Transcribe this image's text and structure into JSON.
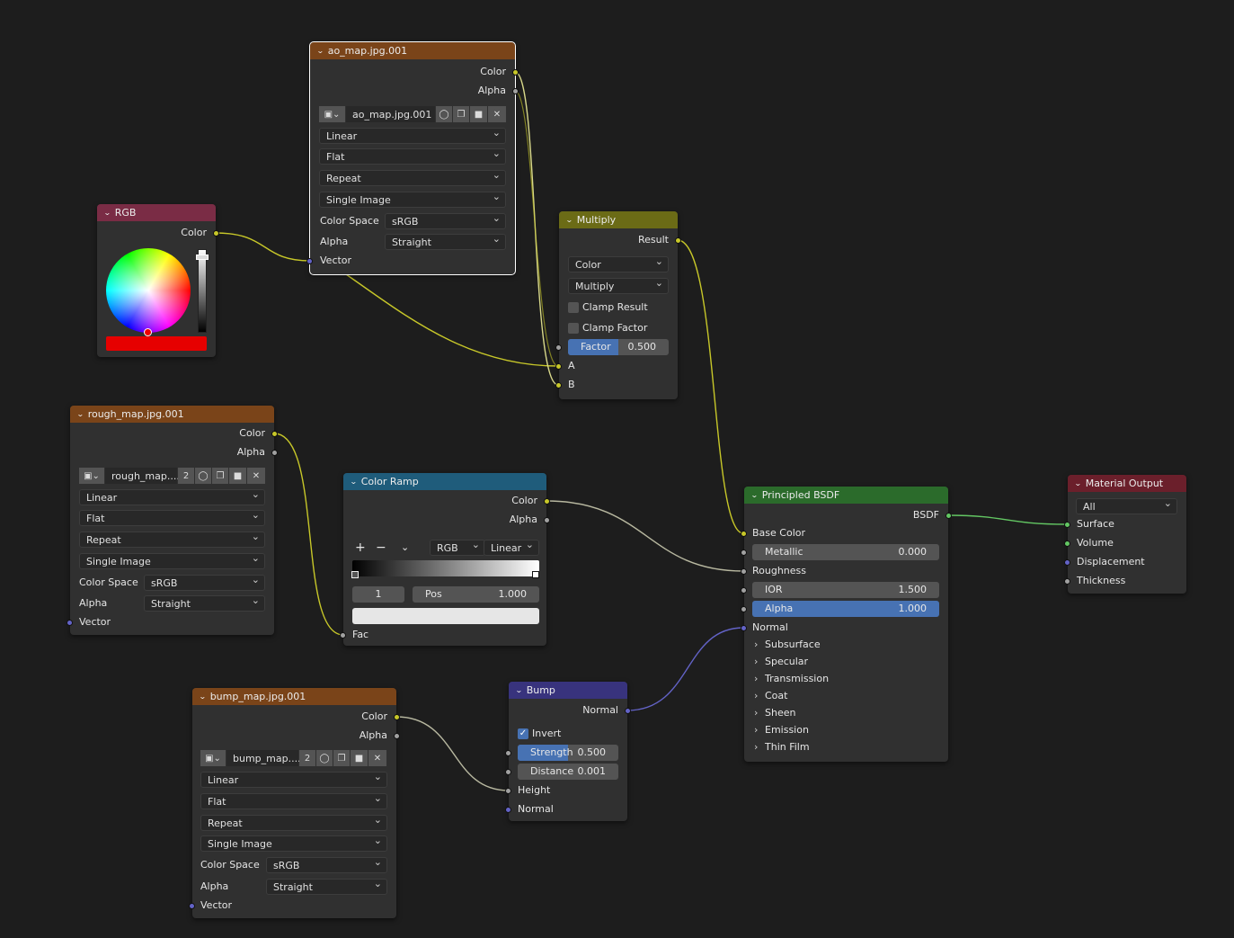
{
  "colors": {
    "canvas": "#1d1d1d",
    "header_texture": "#7a4419",
    "header_color": "#7a2c45",
    "header_converter": "#6b6b16",
    "header_ramp": "#1f5c7b",
    "header_vector": "#38337d",
    "header_shader": "#2b6b2b",
    "header_output": "#6b1f2b",
    "socket_color": "#c7c729",
    "socket_float": "#a1a1a1",
    "socket_vector": "#6363c7",
    "socket_shader": "#63c763",
    "accent": "#4772b3"
  },
  "ao_node": {
    "title": "ao_map.jpg.001",
    "out_color": "Color",
    "out_alpha": "Alpha",
    "image_name": "ao_map.jpg.001",
    "interpolation": "Linear",
    "projection": "Flat",
    "extension": "Repeat",
    "source": "Single Image",
    "colorspace_label": "Color Space",
    "colorspace_value": "sRGB",
    "alpha_label": "Alpha",
    "alpha_value": "Straight",
    "in_vector": "Vector"
  },
  "rgb_node": {
    "title": "RGB",
    "out_color": "Color",
    "swatch_color": "#e60000"
  },
  "multiply_node": {
    "title": "Multiply",
    "out_result": "Result",
    "data_type": "Color",
    "blend_mode": "Multiply",
    "clamp_result_label": "Clamp Result",
    "clamp_result": false,
    "clamp_factor_label": "Clamp Factor",
    "clamp_factor": false,
    "factor_label": "Factor",
    "factor_value": "0.500",
    "in_a": "A",
    "in_b": "B"
  },
  "rough_node": {
    "title": "rough_map.jpg.001",
    "out_color": "Color",
    "out_alpha": "Alpha",
    "image_name": "rough_map....",
    "users": "2",
    "interpolation": "Linear",
    "projection": "Flat",
    "extension": "Repeat",
    "source": "Single Image",
    "colorspace_label": "Color Space",
    "colorspace_value": "sRGB",
    "alpha_label": "Alpha",
    "alpha_value": "Straight",
    "in_vector": "Vector"
  },
  "ramp_node": {
    "title": "Color Ramp",
    "out_color": "Color",
    "out_alpha": "Alpha",
    "add_icon": "+",
    "remove_icon": "−",
    "color_mode": "RGB",
    "interpolation": "Linear",
    "stop_index": "1",
    "pos_label": "Pos",
    "pos_value": "1.000",
    "in_fac": "Fac"
  },
  "bump_map_node": {
    "title": "bump_map.jpg.001",
    "out_color": "Color",
    "out_alpha": "Alpha",
    "image_name": "bump_map....",
    "users": "2",
    "interpolation": "Linear",
    "projection": "Flat",
    "extension": "Repeat",
    "source": "Single Image",
    "colorspace_label": "Color Space",
    "colorspace_value": "sRGB",
    "alpha_label": "Alpha",
    "alpha_value": "Straight",
    "in_vector": "Vector"
  },
  "bump_node": {
    "title": "Bump",
    "out_normal": "Normal",
    "invert_label": "Invert",
    "invert": true,
    "strength_label": "Strength",
    "strength_value": "0.500",
    "distance_label": "Distance",
    "distance_value": "0.001",
    "in_height": "Height",
    "in_normal": "Normal"
  },
  "bsdf_node": {
    "title": "Principled BSDF",
    "out_bsdf": "BSDF",
    "base_color": "Base Color",
    "metallic_label": "Metallic",
    "metallic_value": "0.000",
    "roughness": "Roughness",
    "ior_label": "IOR",
    "ior_value": "1.500",
    "alpha_label": "Alpha",
    "alpha_value": "1.000",
    "normal": "Normal",
    "panels": [
      "Subsurface",
      "Specular",
      "Transmission",
      "Coat",
      "Sheen",
      "Emission",
      "Thin Film"
    ]
  },
  "output_node": {
    "title": "Material Output",
    "target": "All",
    "in_surface": "Surface",
    "in_volume": "Volume",
    "in_displacement": "Displacement",
    "in_thickness": "Thickness"
  },
  "icons": {
    "collapse": "chevron-down-icon",
    "image_browse": "image-icon",
    "fake_user": "shield-icon",
    "duplicate": "duplicate-icon",
    "open": "folder-icon",
    "unlink": "close-icon",
    "panel": "chevron-right-icon"
  }
}
